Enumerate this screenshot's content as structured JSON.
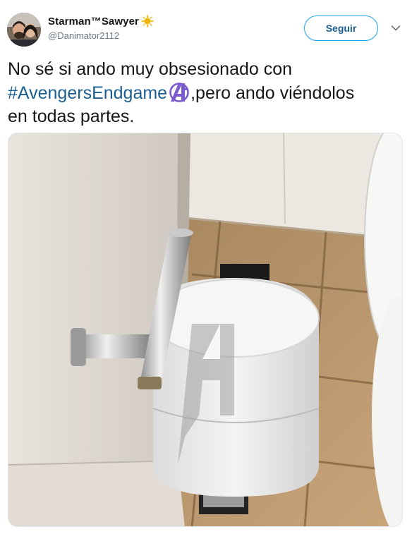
{
  "tweet": {
    "author": {
      "display_name": "Starman™Sawyer",
      "handle": "@Danimator2112"
    },
    "follow_label": "Seguir",
    "text": {
      "line1": "No sé si ando muy obsesionado con",
      "hashtag": "#AvengersEndgame",
      "after_hashtag": ",pero ando viéndolos",
      "line3": "en todas partes."
    }
  },
  "colors": {
    "link": "#1b5f92",
    "follow_border": "#1da1f2",
    "emoji": "#7c5bd1"
  },
  "icons": [
    "avatar",
    "sun-emoji-icon",
    "avengers-logo-icon",
    "chevron-down-icon"
  ]
}
